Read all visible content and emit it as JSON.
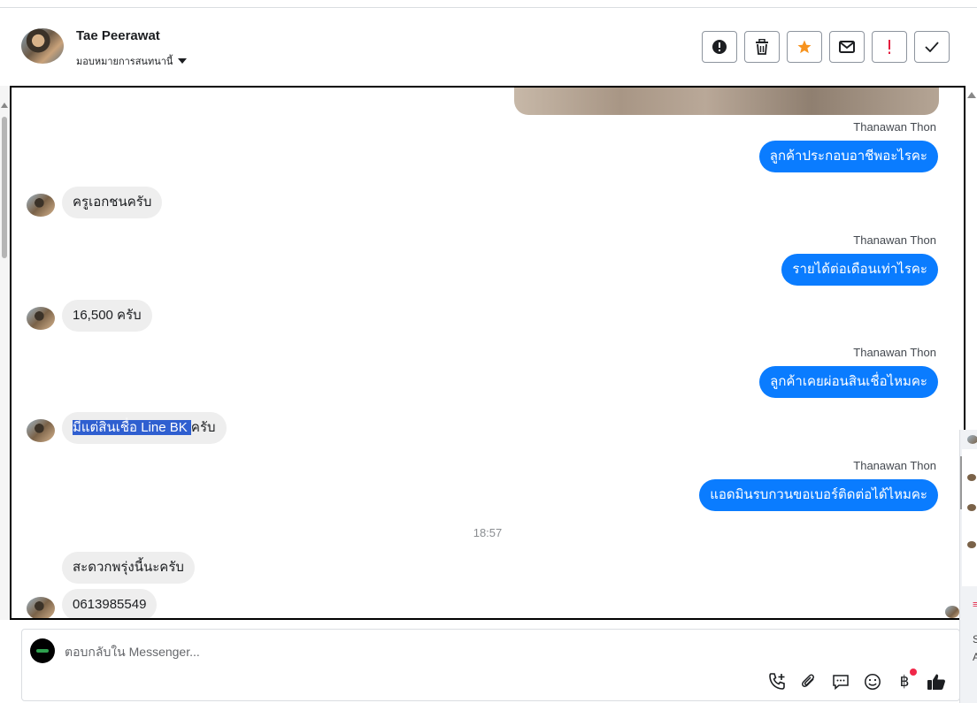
{
  "header": {
    "contact_name": "Tae Peerawat",
    "assign_label": "มอบหมายการสนทนานี้",
    "actions": [
      {
        "name": "report-spam-button",
        "icon": "alert-circle-icon"
      },
      {
        "name": "delete-button",
        "icon": "trash-icon"
      },
      {
        "name": "star-button",
        "icon": "star-icon",
        "color": "#f7931e"
      },
      {
        "name": "mark-unread-button",
        "icon": "envelope-icon"
      },
      {
        "name": "mark-important-button",
        "icon": "exclamation-icon",
        "color": "#e41e3f"
      },
      {
        "name": "mark-done-button",
        "icon": "check-icon"
      }
    ]
  },
  "messages": {
    "out": [
      {
        "sender": "Thanawan Thon",
        "text": "ลูกค้าประกอบอาชีพอะไรคะ"
      },
      {
        "sender": "Thanawan Thon",
        "text": "รายได้ต่อเดือนเท่าไรคะ"
      },
      {
        "sender": "Thanawan Thon",
        "text": "ลูกค้าเคยผ่อนสินเชื่อไหมคะ"
      },
      {
        "sender": "Thanawan Thon",
        "text": "แอดมินรบกวนขอเบอร์ติดต่อได้ไหมคะ"
      }
    ],
    "in": [
      {
        "text": "ครูเอกชนครับ"
      },
      {
        "text": "16,500 ครับ"
      },
      {
        "selected": "มีแต่สินเชื่อ Line BK ",
        "rest": "ครับ"
      },
      {
        "text": "สะดวกพรุ่งนี้นะครับ"
      },
      {
        "text": "0613985549"
      }
    ],
    "time_separator": "18:57"
  },
  "composer": {
    "placeholder": "ตอบกลับใน Messenger..."
  },
  "side_panel": {
    "line1": "S",
    "line2": "A"
  },
  "colors": {
    "accent": "#0a7cff",
    "incoming_bubble": "#eeeeee",
    "selection": "#2f5fd0"
  }
}
